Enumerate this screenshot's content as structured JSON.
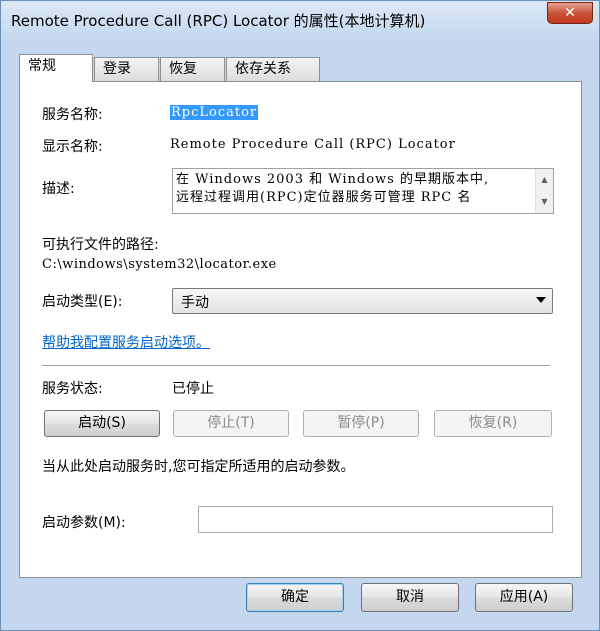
{
  "window": {
    "title": "Remote Procedure Call (RPC) Locator 的属性(本地计算机)",
    "close_label": "✕"
  },
  "tabs": [
    {
      "label": "常规",
      "active": true
    },
    {
      "label": "登录",
      "active": false
    },
    {
      "label": "恢复",
      "active": false
    },
    {
      "label": "依存关系",
      "active": false
    }
  ],
  "general": {
    "service_name_label": "服务名称:",
    "service_name_value": "RpcLocator",
    "display_name_label": "显示名称:",
    "display_name_value": "Remote Procedure Call (RPC) Locator",
    "description_label": "描述:",
    "description_line1": "在 Windows 2003 和 Windows 的早期版本中,",
    "description_line2": "远程过程调用(RPC)定位器服务可管理 RPC 名",
    "exe_path_label": "可执行文件的路径:",
    "exe_path_value": "C:\\windows\\system32\\locator.exe",
    "startup_type_label": "启动类型(E):",
    "startup_type_value": "手动",
    "help_link": "帮助我配置服务启动选项。",
    "status_label": "服务状态:",
    "status_value": "已停止",
    "start_button": "启动(S)",
    "stop_button": "停止(T)",
    "pause_button": "暂停(P)",
    "resume_button": "恢复(R)",
    "hint_text": "当从此处启动服务时,您可指定所适用的启动参数。",
    "start_params_label": "启动参数(M):",
    "start_params_value": ""
  },
  "footer": {
    "ok_button": "确定",
    "cancel_button": "取消",
    "apply_button": "应用(A)"
  }
}
